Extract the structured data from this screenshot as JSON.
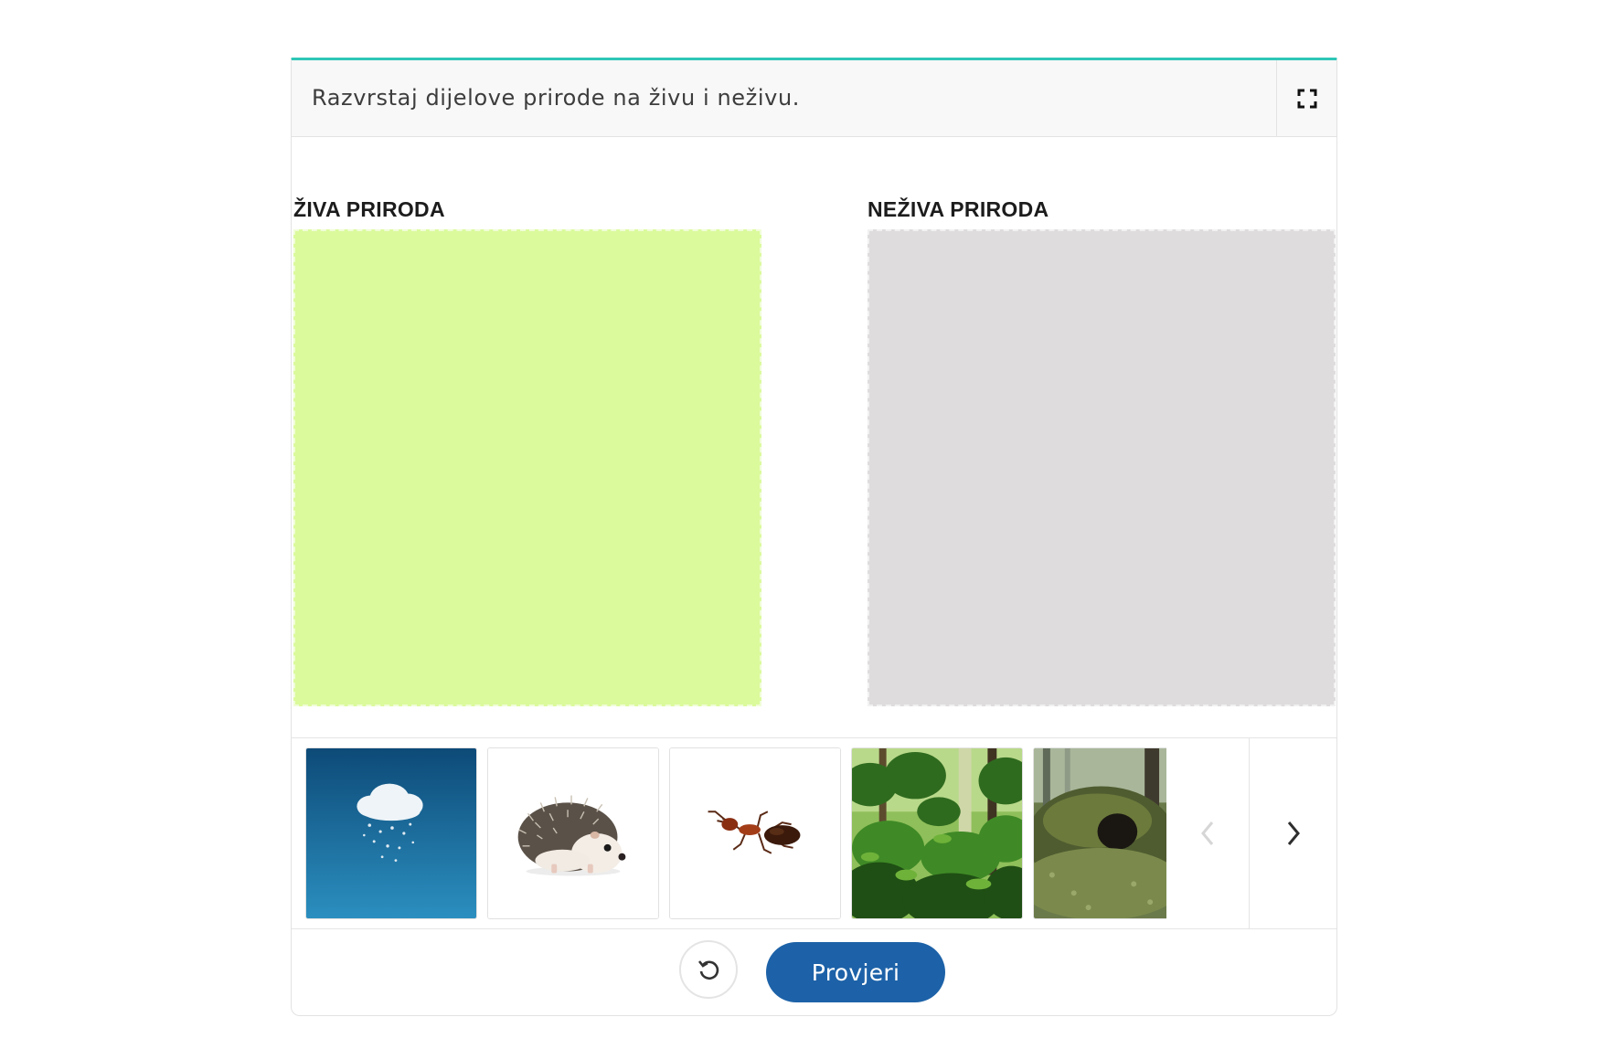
{
  "task": {
    "instruction": "Razvrstaj dijelove prirode na živu i neživu.",
    "fullscreen_icon": "expand-icon"
  },
  "zones": [
    {
      "label": "ŽIVA PRIRODA",
      "color": "#dbfa9c"
    },
    {
      "label": "NEŽIVA PRIRODA",
      "color": "#dedcdd"
    }
  ],
  "tray": {
    "items": [
      {
        "image": "cloud-with-snow"
      },
      {
        "image": "hedgehog"
      },
      {
        "image": "ant"
      },
      {
        "image": "forest"
      },
      {
        "image": "burrow-mound"
      }
    ],
    "prev_icon": "chevron-left-icon",
    "next_icon": "chevron-right-icon"
  },
  "controls": {
    "reset_icon": "reset-icon",
    "check_label": "Provjeri"
  },
  "colors": {
    "accent_top": "#2ec7b6",
    "button_blue": "#1d62a8"
  }
}
